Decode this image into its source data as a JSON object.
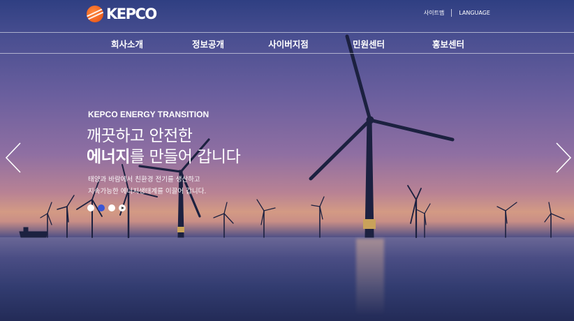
{
  "header": {
    "logo_text": "KEPCO",
    "util_links": [
      "사이트맵",
      "LANGUAGE"
    ]
  },
  "nav": {
    "items": [
      "회사소개",
      "정보공개",
      "사이버지점",
      "민원센터",
      "홍보센터"
    ]
  },
  "hero": {
    "eyebrow": "KEPCO ENERGY TRANSITION",
    "headline_line1": "깨끗하고 안전한",
    "headline_strong": "에너지",
    "headline_rest": "를 만들어 갑니다",
    "desc_line1": "태양과 바람에서 친환경 전기를 생산하고",
    "desc_line2": "지속가능한 에너지생태계를 이끌어 갑니다.",
    "slides_total": 3,
    "slide_active": 2
  },
  "colors": {
    "logo_orange": "#f26522",
    "active_dot": "#3a56d6"
  },
  "icons": [
    "logo-mark-icon",
    "prev-arrow-icon",
    "next-arrow-icon",
    "pause-icon"
  ]
}
